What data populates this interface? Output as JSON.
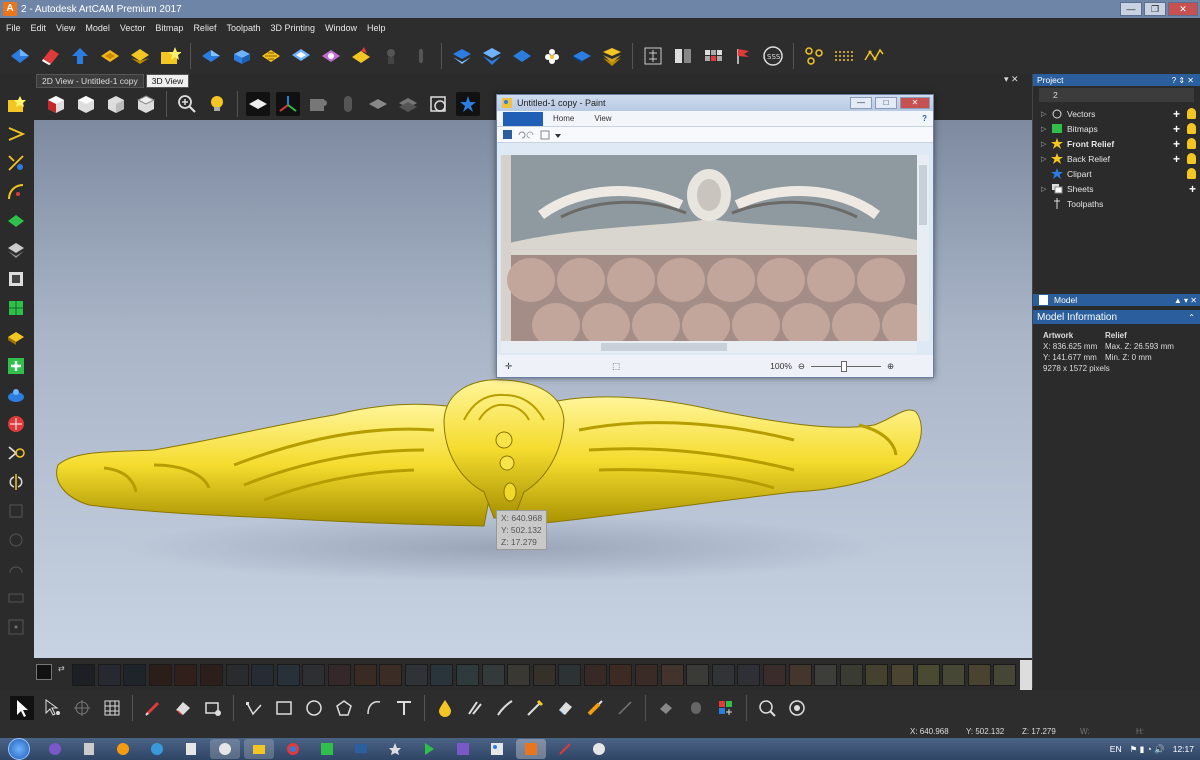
{
  "window": {
    "title": "2 - Autodesk ArtCAM Premium 2017",
    "app_icon_letter": "A",
    "min": "—",
    "max": "❐",
    "close": "✕"
  },
  "menu": [
    "File",
    "Edit",
    "View",
    "Model",
    "Vector",
    "Bitmap",
    "Relief",
    "Toolpath",
    "3D Printing",
    "Window",
    "Help"
  ],
  "view_tabs": [
    {
      "label": "2D View - Untitled-1 copy",
      "active": false
    },
    {
      "label": "3D View",
      "active": true
    }
  ],
  "view_tabs_controls": "▾ ✕",
  "viewport": {
    "cursor_readout": {
      "x": "X: 640.968",
      "y": "Y: 502.132",
      "z": "Z: 17.279"
    }
  },
  "paint_window": {
    "title": "Untitled-1 copy - Paint",
    "min": "—",
    "max": "□",
    "close": "✕",
    "ribbon_tabs": [
      "Home",
      "View"
    ],
    "help": "?",
    "zoom": "100%",
    "zoom_minus": "⊖",
    "zoom_plus": "⊕"
  },
  "project_panel": {
    "header": "Project",
    "header_controls": "? ⇕ ✕",
    "name": "2",
    "items": [
      {
        "label": "Vectors",
        "bold": false,
        "expandable": true,
        "icon": "vectors-icon"
      },
      {
        "label": "Bitmaps",
        "bold": false,
        "expandable": true,
        "icon": "bitmaps-icon"
      },
      {
        "label": "Front Relief",
        "bold": true,
        "expandable": true,
        "icon": "star-icon"
      },
      {
        "label": "Back Relief",
        "bold": false,
        "expandable": true,
        "icon": "star-icon"
      },
      {
        "label": "Clipart",
        "bold": false,
        "expandable": false,
        "icon": "clipart-icon"
      },
      {
        "label": "Sheets",
        "bold": false,
        "expandable": true,
        "icon": "sheets-icon"
      },
      {
        "label": "Toolpaths",
        "bold": false,
        "expandable": false,
        "icon": "toolpaths-icon"
      }
    ]
  },
  "model_panel": {
    "header": "Model",
    "header_controls": "▲ ▾ ✕",
    "info_header": "Model Information",
    "col1_header": "Artwork",
    "col2_header": "Relief",
    "rows": [
      [
        "X: 836.625 mm",
        "Max. Z: 26.593 mm"
      ],
      [
        "Y: 141.677 mm",
        "Min. Z: 0 mm"
      ],
      [
        "9278 x 1572 pixels",
        ""
      ]
    ]
  },
  "palette_colors": [
    "#1c1f24",
    "#262a30",
    "#1f242b",
    "#2b1d18",
    "#301f1a",
    "#2c1e1a",
    "#2a2b2e",
    "#262c33",
    "#28303a",
    "#2d2f33",
    "#34282a",
    "#3a2a24",
    "#3b2c25",
    "#2f3338",
    "#2a353b",
    "#2e3a3c",
    "#343a3c",
    "#3a3833",
    "#36302b",
    "#2d3235",
    "#372a26",
    "#3d2a22",
    "#3a2b27",
    "#42332c",
    "#3a3a37",
    "#313437",
    "#2f3035",
    "#3a2c2a",
    "#44362c",
    "#3d3e39",
    "#3a3c33",
    "#44422f",
    "#4a4430",
    "#4a4a32",
    "#474735",
    "#4a4330",
    "#464636"
  ],
  "status": {
    "x": "X: 640.968",
    "y": "Y: 502.132",
    "z": "Z: 17.279",
    "w": "W:",
    "h": "H:"
  },
  "taskbar": {
    "language": "EN",
    "time": "12:17"
  }
}
